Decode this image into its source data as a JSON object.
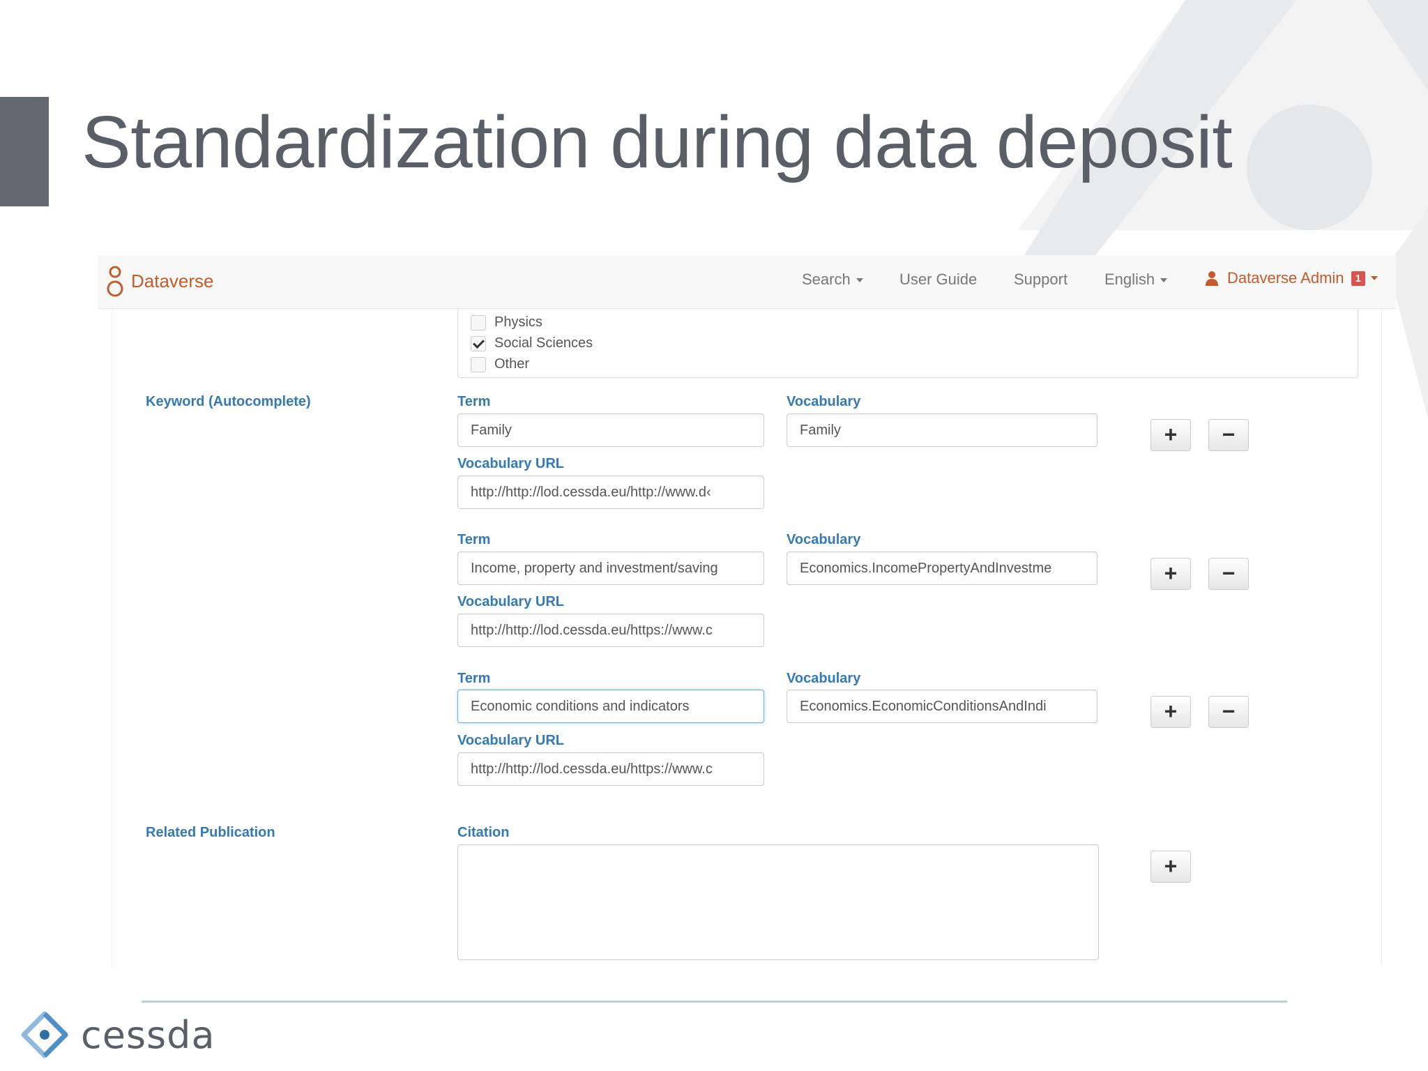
{
  "slide": {
    "title": "Standardization during data deposit"
  },
  "navbar": {
    "brand": "Dataverse",
    "items": [
      {
        "label": "Search",
        "dropdown": true
      },
      {
        "label": "User Guide",
        "dropdown": false
      },
      {
        "label": "Support",
        "dropdown": false
      },
      {
        "label": "English",
        "dropdown": true
      }
    ],
    "user": {
      "label": "Dataverse Admin",
      "notifications": "1"
    }
  },
  "subject": {
    "options": [
      {
        "label": "Physics",
        "checked": false
      },
      {
        "label": "Social Sciences",
        "checked": true
      },
      {
        "label": "Other",
        "checked": false
      }
    ]
  },
  "keyword": {
    "label": "Keyword (Autocomplete)",
    "term_label": "Term",
    "vocabulary_label": "Vocabulary",
    "url_label": "Vocabulary URL",
    "entries": [
      {
        "term": "Family",
        "vocabulary": "Family",
        "url": "http://http://lod.cessda.eu/http://www.d‹"
      },
      {
        "term": "Income, property and investment/saving",
        "vocabulary": "Economics.IncomePropertyAndInvestme",
        "url": "http://http://lod.cessda.eu/https://www.c"
      },
      {
        "term": "Economic conditions and indicators",
        "vocabulary": "Economics.EconomicConditionsAndIndi",
        "url": "http://http://lod.cessda.eu/https://www.c"
      }
    ]
  },
  "related_publication": {
    "label": "Related Publication",
    "citation_label": "Citation",
    "citation_value": ""
  },
  "buttons": {
    "add": "+",
    "remove": "−"
  },
  "footer": {
    "logo_text": "cessda"
  },
  "colors": {
    "title_gray": "#5a5e66",
    "dataverse_orange": "#c55b28",
    "label_blue": "#337ab7",
    "footer_line": "#b9cfe6"
  }
}
